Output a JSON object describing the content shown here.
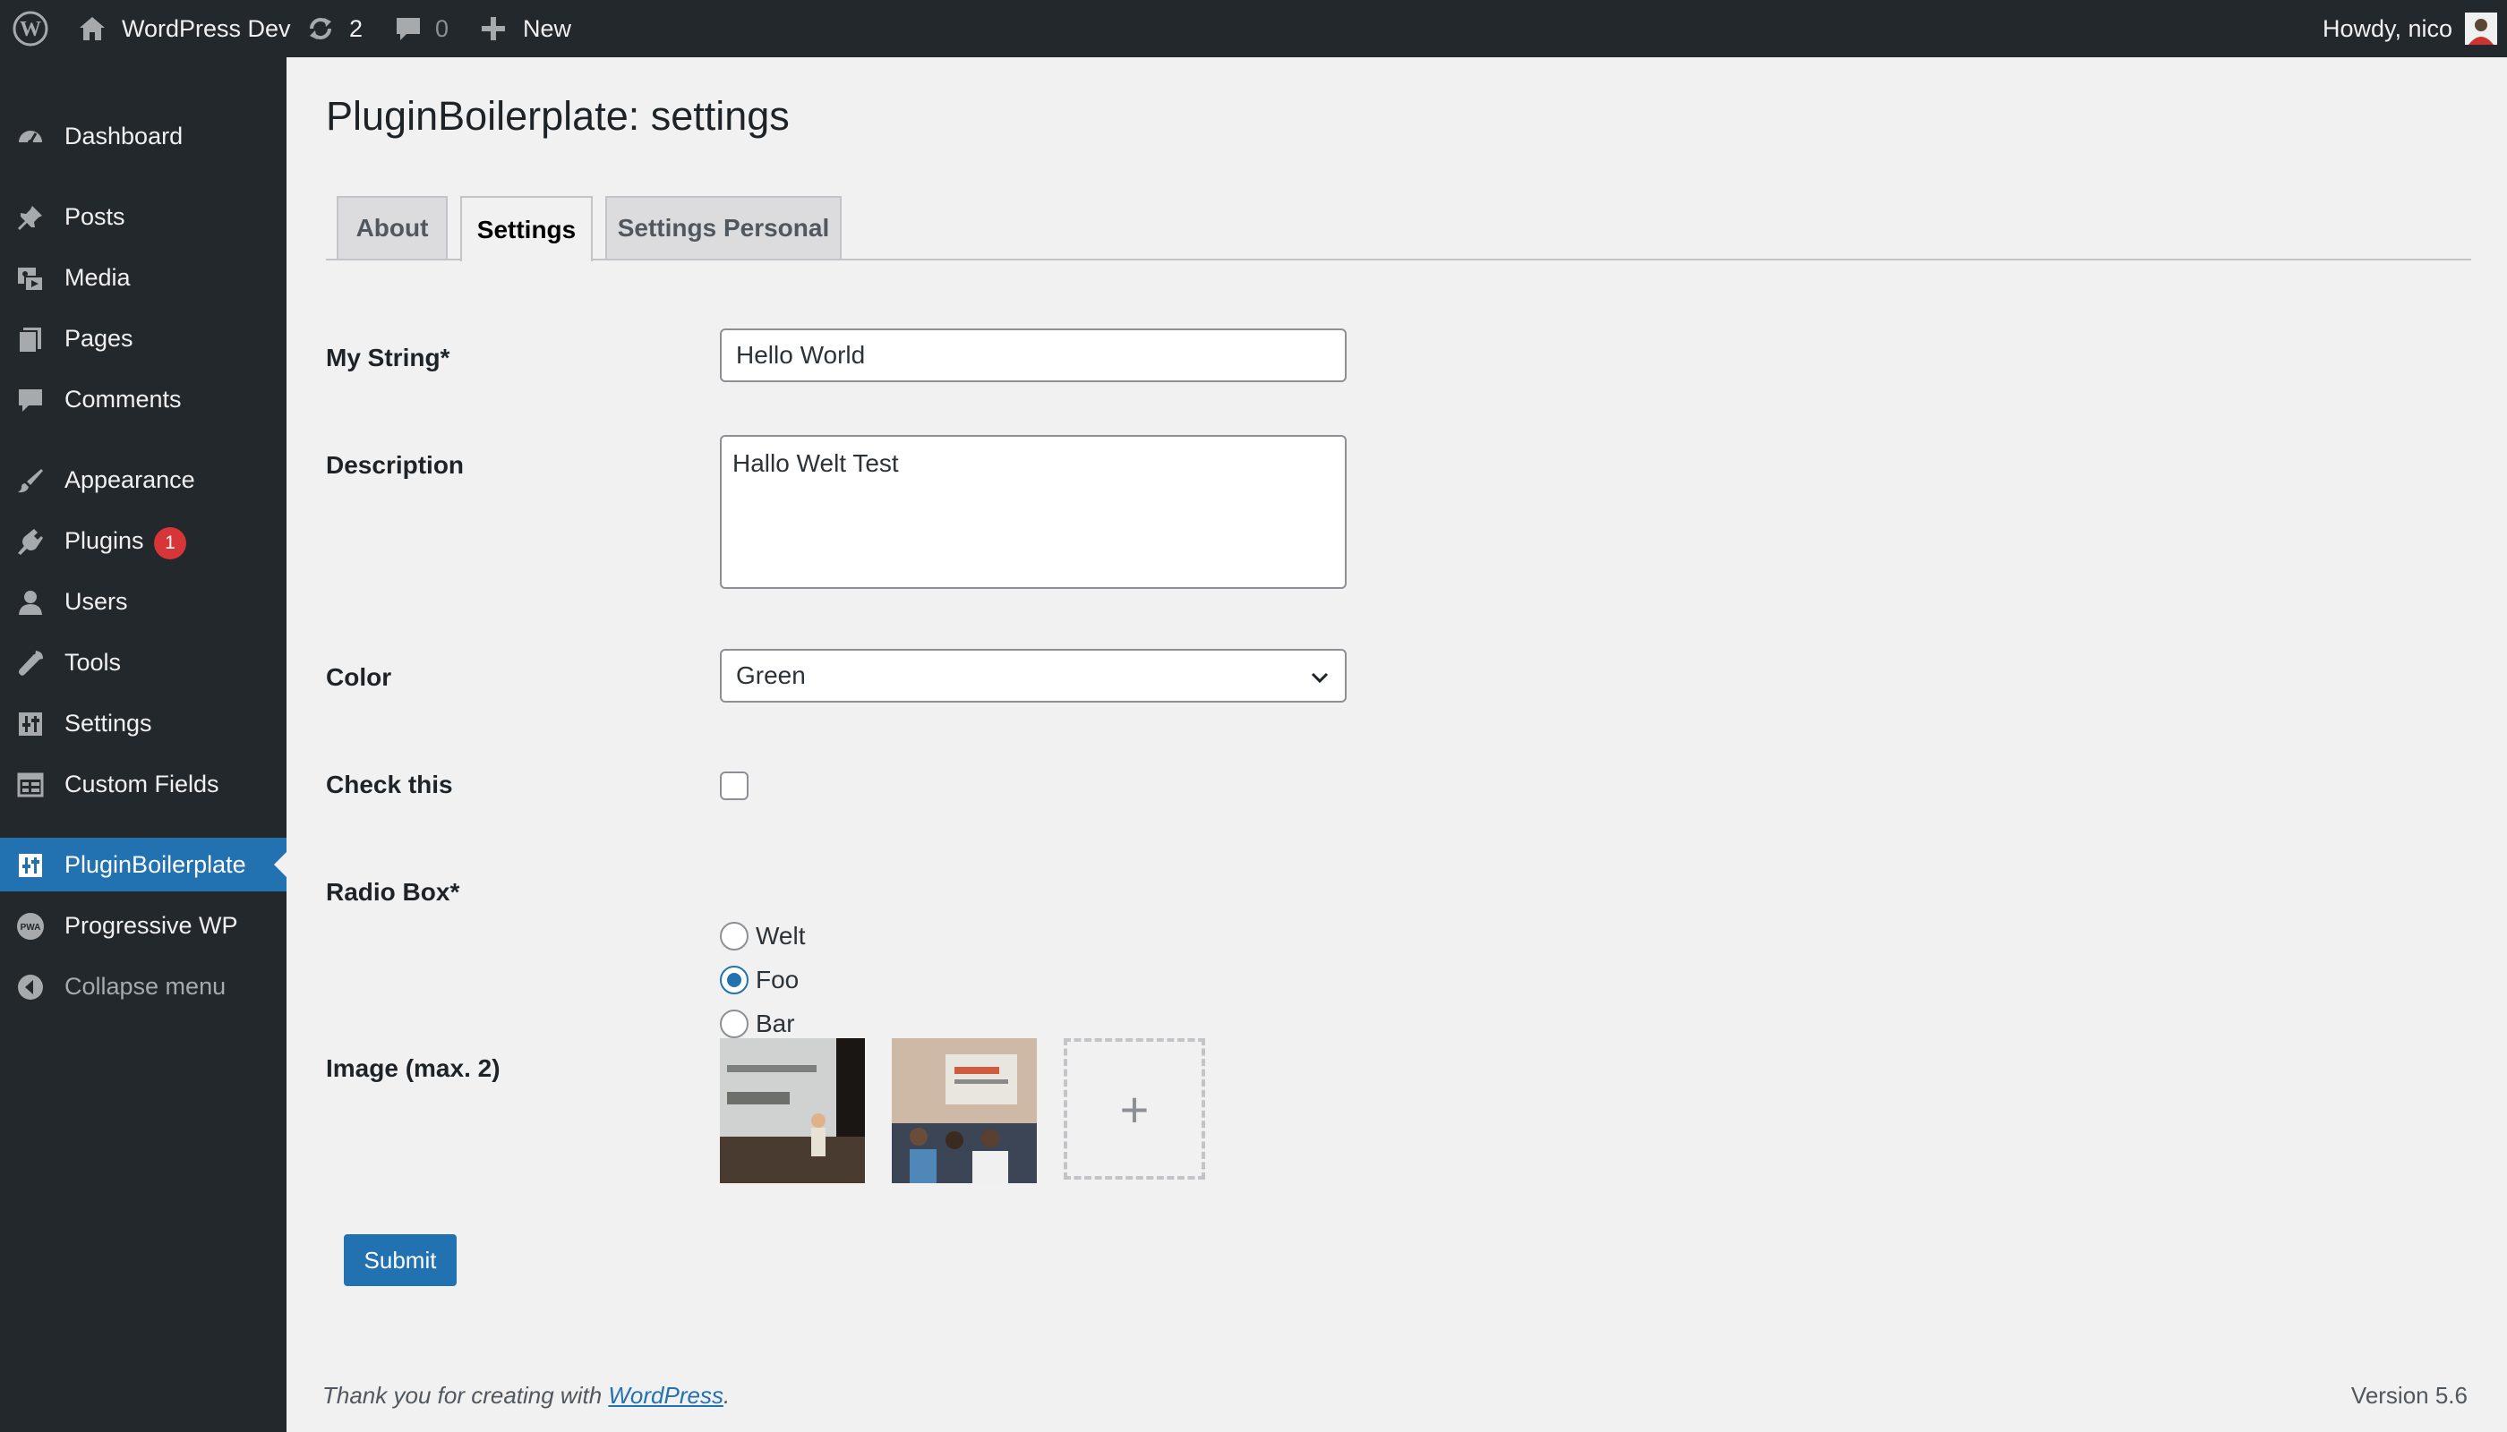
{
  "adminbar": {
    "site_name": "WordPress Dev",
    "updates_count": "2",
    "comments_count": "0",
    "new_label": "New",
    "howdy": "Howdy, nico"
  },
  "sidebar": {
    "items": [
      {
        "label": "Dashboard",
        "icon": "dashboard-icon"
      },
      {
        "label": "Posts",
        "icon": "pin-icon"
      },
      {
        "label": "Media",
        "icon": "media-icon"
      },
      {
        "label": "Pages",
        "icon": "pages-icon"
      },
      {
        "label": "Comments",
        "icon": "comment-icon"
      },
      {
        "label": "Appearance",
        "icon": "brush-icon"
      },
      {
        "label": "Plugins",
        "icon": "plugin-icon",
        "badge": "1"
      },
      {
        "label": "Users",
        "icon": "user-icon"
      },
      {
        "label": "Tools",
        "icon": "wrench-icon"
      },
      {
        "label": "Settings",
        "icon": "sliders-icon"
      },
      {
        "label": "Custom Fields",
        "icon": "table-icon"
      },
      {
        "label": "PluginBoilerplate",
        "icon": "sliders-icon",
        "current": true
      },
      {
        "label": "Progressive WP",
        "icon": "pwa-icon"
      },
      {
        "label": "Collapse menu",
        "icon": "collapse-icon"
      }
    ]
  },
  "page": {
    "title": "PluginBoilerplate: settings",
    "tabs": [
      "About",
      "Settings",
      "Settings Personal"
    ],
    "active_tab": "Settings"
  },
  "form": {
    "my_string": {
      "label": "My String*",
      "value": "Hello World"
    },
    "description": {
      "label": "Description",
      "value": "Hallo Welt Test"
    },
    "color": {
      "label": "Color",
      "value": "Green"
    },
    "check": {
      "label": "Check this",
      "checked": false
    },
    "radio": {
      "label": "Radio Box*",
      "options": [
        "Welt",
        "Foo",
        "Bar"
      ],
      "selected": "Foo"
    },
    "image": {
      "label": "Image (max. 2)",
      "add_glyph": "+"
    },
    "submit_label": "Submit"
  },
  "footer": {
    "thanks_prefix": "Thank you for creating with ",
    "thanks_link": "WordPress",
    "thanks_suffix": ".",
    "version": "Version 5.6"
  },
  "colors": {
    "accent": "#2271b1",
    "adminbar_bg": "#23282d",
    "badge": "#d63638"
  }
}
